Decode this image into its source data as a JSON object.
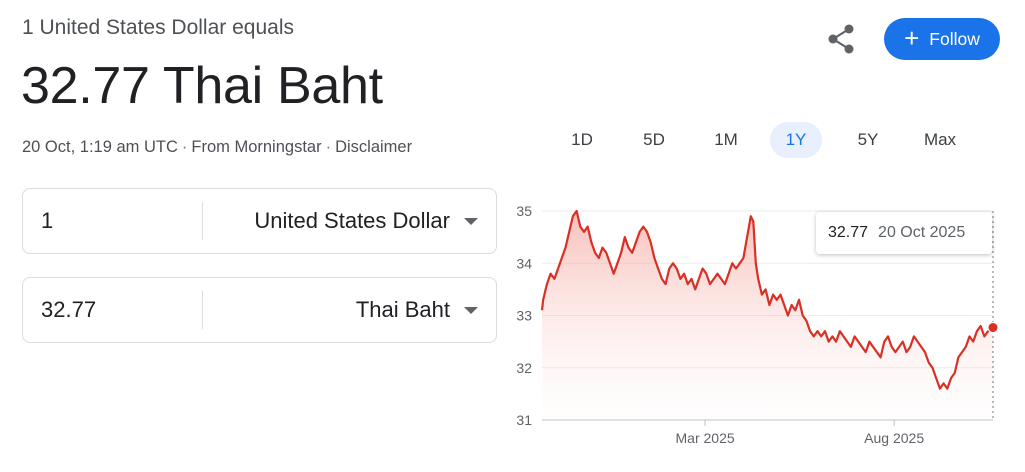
{
  "header": {
    "subtitle": "1 United States Dollar equals",
    "value": "32.77",
    "currency_name": "Thai Baht"
  },
  "meta": {
    "timestamp": "20 Oct, 1:19 am UTC",
    "separator": "·",
    "source": "From Morningstar",
    "disclaimer": "Disclaimer"
  },
  "actions": {
    "share_icon": "share-icon",
    "follow_label": "Follow",
    "follow_color": "#1a73e8"
  },
  "converter": {
    "from": {
      "amount": "1",
      "currency": "United States Dollar"
    },
    "to": {
      "amount": "32.77",
      "currency": "Thai Baht"
    }
  },
  "range_tabs": [
    {
      "label": "1D",
      "active": false
    },
    {
      "label": "5D",
      "active": false
    },
    {
      "label": "1M",
      "active": false
    },
    {
      "label": "1Y",
      "active": true
    },
    {
      "label": "5Y",
      "active": false
    },
    {
      "label": "Max",
      "active": false
    }
  ],
  "tooltip": {
    "value": "32.77",
    "date": "20 Oct 2025"
  },
  "chart_data": {
    "type": "area",
    "line_color": "#d93025",
    "ylim": [
      31,
      35
    ],
    "y_ticks": [
      "31",
      "32",
      "33",
      "34",
      "35"
    ],
    "x_ticks": [
      "Mar 2025",
      "Aug 2025"
    ],
    "x_range": [
      "2024-10-20",
      "2025-10-20"
    ],
    "grid": true,
    "series": [
      {
        "points": [
          [
            "2024-10-20",
            33.1
          ],
          [
            "2024-10-21",
            33.3
          ],
          [
            "2024-10-24",
            33.6
          ],
          [
            "2024-10-27",
            33.8
          ],
          [
            "2024-10-30",
            33.7
          ],
          [
            "2024-11-02",
            33.9
          ],
          [
            "2024-11-05",
            34.1
          ],
          [
            "2024-11-08",
            34.3
          ],
          [
            "2024-11-11",
            34.6
          ],
          [
            "2024-11-14",
            34.9
          ],
          [
            "2024-11-17",
            35.0
          ],
          [
            "2024-11-20",
            34.7
          ],
          [
            "2024-11-23",
            34.6
          ],
          [
            "2024-11-26",
            34.7
          ],
          [
            "2024-11-29",
            34.4
          ],
          [
            "2024-12-02",
            34.2
          ],
          [
            "2024-12-05",
            34.1
          ],
          [
            "2024-12-08",
            34.3
          ],
          [
            "2024-12-11",
            34.2
          ],
          [
            "2024-12-14",
            34.0
          ],
          [
            "2024-12-17",
            33.8
          ],
          [
            "2024-12-20",
            34.0
          ],
          [
            "2024-12-23",
            34.2
          ],
          [
            "2024-12-26",
            34.5
          ],
          [
            "2024-12-29",
            34.3
          ],
          [
            "2025-01-01",
            34.2
          ],
          [
            "2025-01-04",
            34.4
          ],
          [
            "2025-01-07",
            34.6
          ],
          [
            "2025-01-10",
            34.7
          ],
          [
            "2025-01-13",
            34.6
          ],
          [
            "2025-01-16",
            34.4
          ],
          [
            "2025-01-19",
            34.1
          ],
          [
            "2025-01-22",
            33.9
          ],
          [
            "2025-01-25",
            33.7
          ],
          [
            "2025-01-28",
            33.6
          ],
          [
            "2025-01-31",
            33.9
          ],
          [
            "2025-02-03",
            34.0
          ],
          [
            "2025-02-06",
            33.9
          ],
          [
            "2025-02-09",
            33.7
          ],
          [
            "2025-02-12",
            33.8
          ],
          [
            "2025-02-15",
            33.6
          ],
          [
            "2025-02-18",
            33.7
          ],
          [
            "2025-02-21",
            33.5
          ],
          [
            "2025-02-24",
            33.7
          ],
          [
            "2025-02-27",
            33.9
          ],
          [
            "2025-03-02",
            33.8
          ],
          [
            "2025-03-05",
            33.6
          ],
          [
            "2025-03-08",
            33.7
          ],
          [
            "2025-03-11",
            33.8
          ],
          [
            "2025-03-14",
            33.7
          ],
          [
            "2025-03-17",
            33.6
          ],
          [
            "2025-03-20",
            33.8
          ],
          [
            "2025-03-23",
            34.0
          ],
          [
            "2025-03-26",
            33.9
          ],
          [
            "2025-03-29",
            34.0
          ],
          [
            "2025-04-01",
            34.1
          ],
          [
            "2025-04-04",
            34.5
          ],
          [
            "2025-04-07",
            34.9
          ],
          [
            "2025-04-09",
            34.8
          ],
          [
            "2025-04-11",
            34.0
          ],
          [
            "2025-04-13",
            33.7
          ],
          [
            "2025-04-16",
            33.4
          ],
          [
            "2025-04-19",
            33.5
          ],
          [
            "2025-04-22",
            33.2
          ],
          [
            "2025-04-25",
            33.4
          ],
          [
            "2025-04-28",
            33.3
          ],
          [
            "2025-05-01",
            33.4
          ],
          [
            "2025-05-04",
            33.2
          ],
          [
            "2025-05-07",
            33.0
          ],
          [
            "2025-05-10",
            33.2
          ],
          [
            "2025-05-13",
            33.1
          ],
          [
            "2025-05-16",
            33.3
          ],
          [
            "2025-05-19",
            33.0
          ],
          [
            "2025-05-22",
            32.9
          ],
          [
            "2025-05-25",
            32.7
          ],
          [
            "2025-05-28",
            32.6
          ],
          [
            "2025-05-31",
            32.7
          ],
          [
            "2025-06-03",
            32.6
          ],
          [
            "2025-06-06",
            32.7
          ],
          [
            "2025-06-09",
            32.5
          ],
          [
            "2025-06-12",
            32.6
          ],
          [
            "2025-06-15",
            32.5
          ],
          [
            "2025-06-18",
            32.7
          ],
          [
            "2025-06-21",
            32.6
          ],
          [
            "2025-06-24",
            32.5
          ],
          [
            "2025-06-27",
            32.4
          ],
          [
            "2025-06-30",
            32.6
          ],
          [
            "2025-07-03",
            32.5
          ],
          [
            "2025-07-06",
            32.4
          ],
          [
            "2025-07-09",
            32.3
          ],
          [
            "2025-07-12",
            32.5
          ],
          [
            "2025-07-15",
            32.4
          ],
          [
            "2025-07-18",
            32.3
          ],
          [
            "2025-07-21",
            32.2
          ],
          [
            "2025-07-24",
            32.5
          ],
          [
            "2025-07-27",
            32.6
          ],
          [
            "2025-07-30",
            32.4
          ],
          [
            "2025-08-02",
            32.3
          ],
          [
            "2025-08-05",
            32.4
          ],
          [
            "2025-08-08",
            32.5
          ],
          [
            "2025-08-11",
            32.3
          ],
          [
            "2025-08-14",
            32.4
          ],
          [
            "2025-08-17",
            32.6
          ],
          [
            "2025-08-20",
            32.5
          ],
          [
            "2025-08-23",
            32.4
          ],
          [
            "2025-08-26",
            32.3
          ],
          [
            "2025-08-29",
            32.1
          ],
          [
            "2025-09-01",
            32.0
          ],
          [
            "2025-09-04",
            31.8
          ],
          [
            "2025-09-07",
            31.6
          ],
          [
            "2025-09-10",
            31.7
          ],
          [
            "2025-09-13",
            31.6
          ],
          [
            "2025-09-16",
            31.8
          ],
          [
            "2025-09-19",
            31.9
          ],
          [
            "2025-09-22",
            32.2
          ],
          [
            "2025-09-25",
            32.3
          ],
          [
            "2025-09-28",
            32.4
          ],
          [
            "2025-10-01",
            32.6
          ],
          [
            "2025-10-04",
            32.5
          ],
          [
            "2025-10-07",
            32.7
          ],
          [
            "2025-10-10",
            32.8
          ],
          [
            "2025-10-13",
            32.6
          ],
          [
            "2025-10-16",
            32.7
          ],
          [
            "2025-10-20",
            32.77
          ]
        ]
      }
    ]
  }
}
